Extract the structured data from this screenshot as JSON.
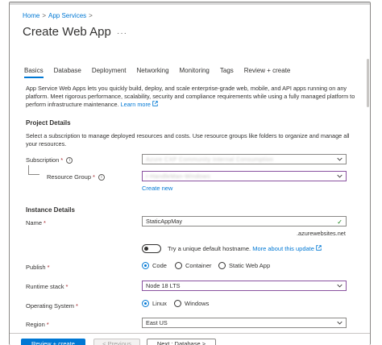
{
  "breadcrumb": {
    "home": "Home",
    "app_services": "App Services",
    "sep": ">"
  },
  "page": {
    "title": "Create Web App",
    "more": "···"
  },
  "tabs": [
    {
      "label": "Basics"
    },
    {
      "label": "Database"
    },
    {
      "label": "Deployment"
    },
    {
      "label": "Networking"
    },
    {
      "label": "Monitoring"
    },
    {
      "label": "Tags"
    },
    {
      "label": "Review + create"
    }
  ],
  "intro": {
    "text": "App Service Web Apps lets you quickly build, deploy, and scale enterprise-grade web, mobile, and API apps running on any platform. Meet rigorous performance, scalability, security and compliance requirements while using a fully managed platform to perform infrastructure maintenance.",
    "learn_more": "Learn more"
  },
  "project_details": {
    "heading": "Project Details",
    "description": "Select a subscription to manage deployed resources and costs. Use resource groups like folders to organize and manage all your resources.",
    "subscription_label": "Subscription",
    "subscription_value": "Azure CXP Community Internal Consumption",
    "resource_group_label": "Resource Group",
    "resource_group_value": "r-HandleMan-Windows",
    "create_new": "Create new"
  },
  "instance_details": {
    "heading": "Instance Details",
    "name_label": "Name",
    "name_value": "StaticAppMay",
    "name_suffix": ".azurewebsites.net",
    "toggle_text": "Try a unique default hostname.",
    "toggle_link": "More about this update",
    "publish_label": "Publish",
    "publish_options": [
      "Code",
      "Container",
      "Static Web App"
    ],
    "runtime_label": "Runtime stack",
    "runtime_value": "Node 18 LTS",
    "os_label": "Operating System",
    "os_options": [
      "Linux",
      "Windows"
    ],
    "region_label": "Region",
    "region_value": "East US",
    "required_mark": "*"
  },
  "footer": {
    "review_create": "Review + create",
    "previous": "< Previous",
    "next": "Next : Database >"
  },
  "colors": {
    "accent": "#0078d4",
    "required": "#a4262c",
    "valid": "#107c10"
  },
  "icons": [
    "info-icon",
    "chevron-down-icon",
    "checkmark-icon",
    "external-link-icon"
  ]
}
